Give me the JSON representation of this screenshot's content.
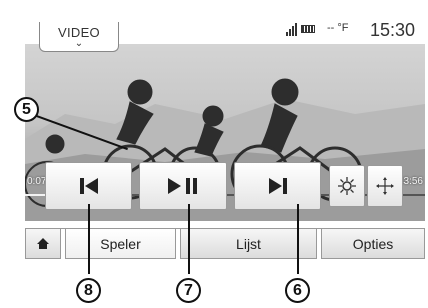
{
  "status_bar": {
    "video_tab_label": "VIDEO",
    "temperature": "-- °F",
    "clock": "15:30",
    "signal_icon": "signal-icon",
    "battery_icon": "battery-icon"
  },
  "player": {
    "current_time": "0:07:36",
    "total_time": "1:43:56",
    "progress_fraction": 0.07,
    "controls": {
      "previous_icon": "skip-previous-icon",
      "play_pause_icon": "play-pause-icon",
      "next_icon": "skip-next-icon",
      "brightness_icon": "brightness-icon",
      "move_icon": "move-arrows-icon"
    }
  },
  "tabs": {
    "home_icon": "home-icon",
    "speler": "Speler",
    "lijst": "Lijst",
    "opties": "Opties"
  },
  "callouts": {
    "c5": "5",
    "c6": "6",
    "c7": "7",
    "c8": "8"
  }
}
